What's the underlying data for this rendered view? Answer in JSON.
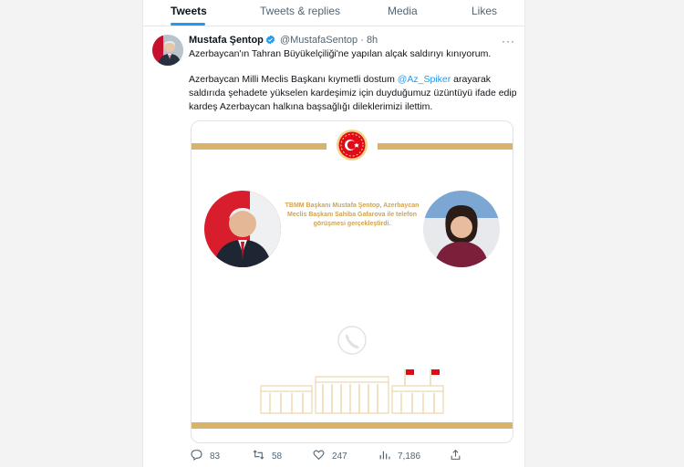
{
  "tabs": [
    {
      "label": "Tweets"
    },
    {
      "label": "Tweets & replies"
    },
    {
      "label": "Media"
    },
    {
      "label": "Likes"
    }
  ],
  "tweet": {
    "author_name": "Mustafa Şentop",
    "handle": "@MustafaSentop",
    "separator": "·",
    "time": "8h",
    "more": "···",
    "line1": "Azerbaycan'ın Tahran Büyükelçiliği'ne yapılan alçak saldırıyı kınıyorum.",
    "p2_start": "Azerbaycan Milli Meclis Başkanı kıymetli dostum ",
    "mention": "@Az_Spiker",
    "p2_end": " arayarak saldırıda şehadete yükselen kardeşimiz için duyduğumuz üzüntüyü ifade edip kardeş Azerbaycan halkına başsağlığı dileklerimizi ilettim.",
    "card_text": "TBMM Başkanı Mustafa Şentop, Azerbaycan Meclis Başkanı Sahiba Gafarova ile telefon görüşmesi gerçekleştirdi."
  },
  "actions": {
    "replies": "83",
    "retweets": "58",
    "likes": "247",
    "views": "7,186"
  },
  "colors": {
    "accent": "#1d9bf0",
    "gold": "#d9b36c",
    "turkish_red": "#e30a17"
  }
}
